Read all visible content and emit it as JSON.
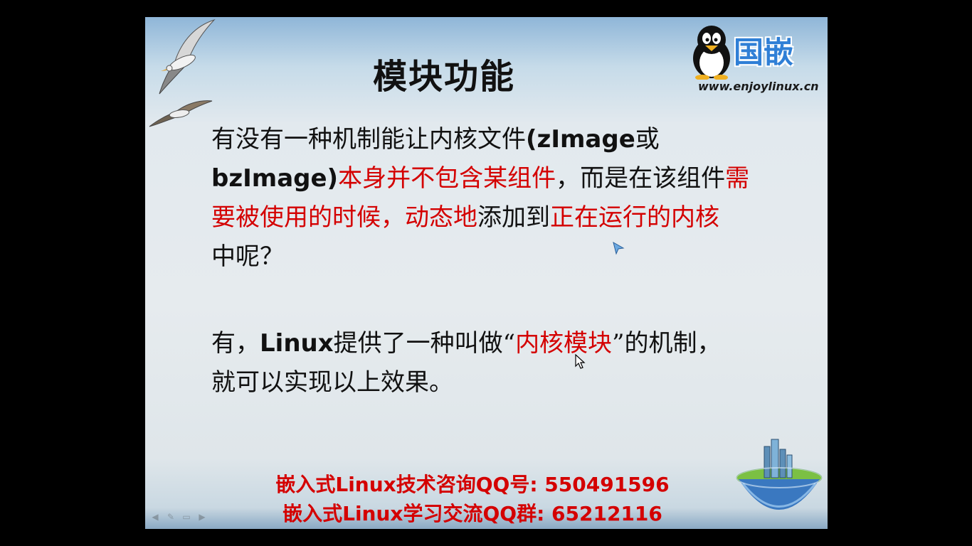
{
  "slide": {
    "title": "模块功能",
    "logo": {
      "brand": "国嵌",
      "url": "www.enjoylinux.cn"
    },
    "paragraph1": {
      "line1_a": "有没有一种机制能让内核文件",
      "line1_b": "(zImage",
      "line1_c": "或",
      "line2_a": "bzImage)",
      "line2_b": "本身并不包含某组件",
      "line2_c": "，而是在该组件",
      "line2_d": "需",
      "line3_a": "要被使用的时候，动态地",
      "line3_b": "添加到",
      "line3_c": "正在运行的内核",
      "line4": "中呢？"
    },
    "paragraph2": {
      "line1_a": "有，",
      "line1_b": "Linux",
      "line1_c": "提供了一种叫做",
      "line1_d": "“",
      "line1_e": "内核模块",
      "line1_f": "”",
      "line1_g": "的机制，",
      "line2": "就可以实现以上效果。"
    },
    "contact": {
      "line1": "嵌入式Linux技术咨询QQ号: 550491596",
      "line2": "嵌入式Linux学习交流QQ群: 65212116"
    },
    "nav_icons": [
      "arrow-left-icon",
      "pen-icon",
      "menu-icon",
      "arrow-right-icon"
    ]
  },
  "colors": {
    "highlight": "#d40000",
    "background": "#000000",
    "logo_blue": "#2f7fd6"
  }
}
